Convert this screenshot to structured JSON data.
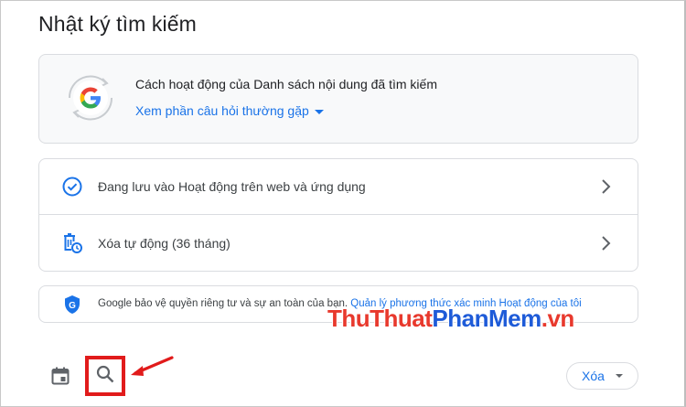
{
  "page": {
    "title": "Nhật ký tìm kiếm"
  },
  "info_card": {
    "text": "Cách hoạt động của Danh sách nội dung đã tìm kiếm",
    "faq_link": "Xem phần câu hỏi thường gặp",
    "logo_icon": "google-g-logo"
  },
  "settings": {
    "items": [
      {
        "label": "Đang lưu vào Hoạt động trên web và ứng dụng",
        "icon": "check-circle-icon"
      },
      {
        "label": "Xóa tự động (36 tháng)",
        "icon": "auto-delete-icon"
      }
    ]
  },
  "privacy": {
    "text": "Google bảo vệ quyền riêng tư và sự an toàn của bạn.",
    "link": "Quản lý phương thức xác minh Hoạt động của tôi",
    "icon": "shield-icon"
  },
  "watermark": {
    "part1": "ThuThuat",
    "part2": "PhanMem",
    "part3": ".vn"
  },
  "toolbar": {
    "calendar_icon": "calendar-icon",
    "search_icon": "search-icon",
    "delete_label": "Xóa"
  },
  "colors": {
    "link_blue": "#1a73e8",
    "highlight_red": "#e11b1b",
    "border": "#dadce0"
  }
}
